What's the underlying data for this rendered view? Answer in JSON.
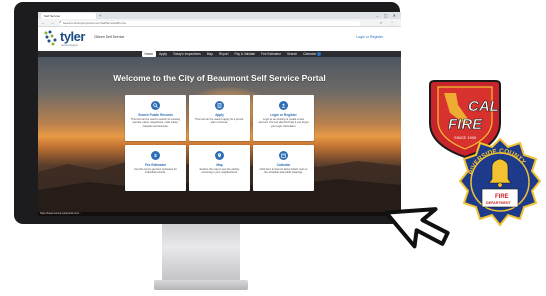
{
  "browser": {
    "tab_title": "Self Service",
    "new_tab": "+",
    "window_controls": "– ▢ ✕",
    "nav_icons": "← → ↻",
    "url": "beaumontca.tylerportal.com/SelfService#/home",
    "right_icons": "☆ ⋮"
  },
  "site": {
    "logo_text": "tyler",
    "logo_sub": "technologies",
    "portal_title": "Citizen Self Service",
    "login_link": "Login or Register"
  },
  "nav": {
    "items": [
      "Home",
      "Apply",
      "Today's Inspections",
      "Map",
      "Report",
      "Pay & Validate",
      "Fee Estimator",
      "Search",
      "Calendar"
    ]
  },
  "hero": {
    "title": "Welcome to the City of Beaumont Self Service Portal"
  },
  "cards": [
    {
      "title": "Search Public Records",
      "desc": "This tool can be used to search for existing permits, plans, inspections, code cases, requests and licenses.",
      "icon": "search-icon"
    },
    {
      "title": "Apply",
      "desc": "This tool can be used to apply for a permit, plan or license.",
      "icon": "apply-icon"
    },
    {
      "title": "Login or Register",
      "desc": "Login to an existing or create a new account. You can also find help if you forgot your login information.",
      "icon": "user-icon"
    },
    {
      "title": "Fee Estimator",
      "desc": "Use this tool to get fees estimates for individual records.",
      "icon": "dollar-icon"
    },
    {
      "title": "Map",
      "desc": "Explore the map to see the activity occurring in your neighborhood.",
      "icon": "map-pin-icon"
    },
    {
      "title": "Calendar",
      "desc": "Click here to find out about what's next on the schedule and public hearings.",
      "icon": "calendar-icon"
    }
  ],
  "status": {
    "text": "https://beaumontca.tylerportal.com/..."
  },
  "badges": {
    "calfire_top": "CAL",
    "calfire_main": "FIRE",
    "calfire_since": "SINCE 1905",
    "riverside_arc": "RIVERSIDE COUNTY",
    "riverside_bottom": "FIRE",
    "riverside_dept": "DEPARTMENT"
  },
  "colors": {
    "brand": "#1f4e87",
    "accent": "#2d6db5",
    "nav_bg": "#2b2d31",
    "calfire_red": "#c8242b",
    "riverside_blue": "#1d3b8a",
    "gold": "#f2c232"
  }
}
